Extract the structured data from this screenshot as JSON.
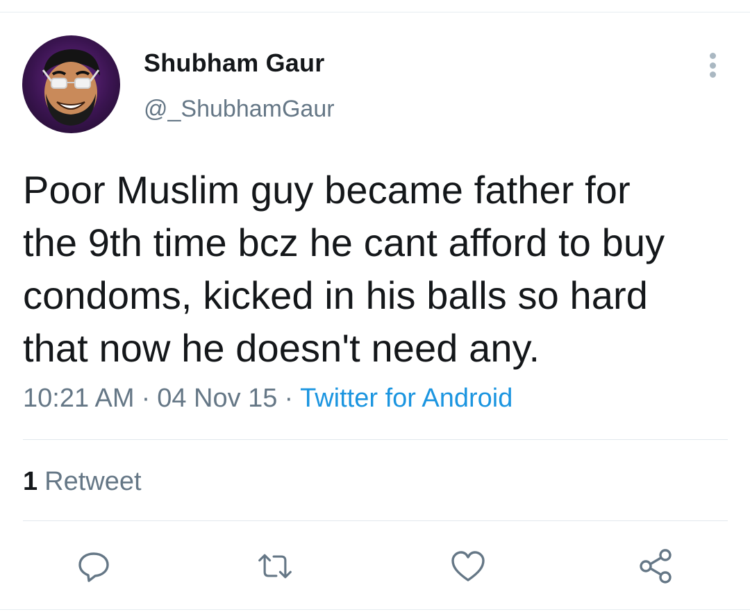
{
  "author": {
    "display_name": "Shubham Gaur",
    "handle": "@_ShubhamGaur"
  },
  "tweet": {
    "text": "Poor Muslim guy became father for\nthe 9th time bcz he cant afford to buy\ncondoms, kicked in his balls so hard\nthat now he doesn't need any.",
    "time": "10:21 AM",
    "date": "04 Nov 15",
    "separator": "·",
    "source": "Twitter for Android"
  },
  "stats": {
    "retweet_count": "1",
    "retweet_label": "Retweet"
  },
  "actions": {
    "reply_icon": "reply-icon",
    "retweet_icon": "retweet-icon",
    "like_icon": "heart-icon",
    "share_icon": "share-icon"
  },
  "colors": {
    "text": "#14171a",
    "secondary": "#657786",
    "link": "#1b95e0",
    "icon": "#657786",
    "divider": "#e1e8ed"
  }
}
